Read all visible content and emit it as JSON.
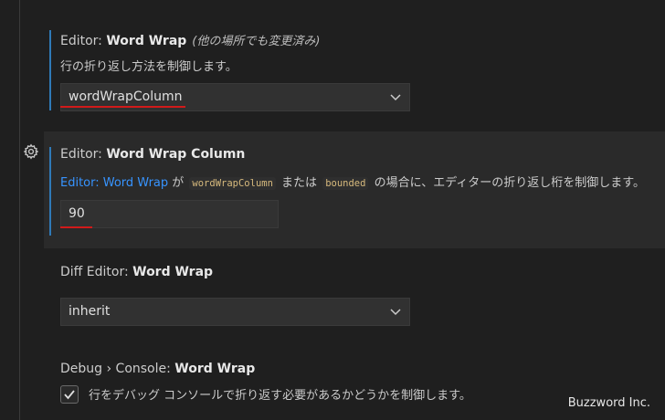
{
  "settings": {
    "word_wrap": {
      "category": "Editor: ",
      "name": "Word Wrap",
      "note": "(他の場所でも変更済み)",
      "description": "行の折り返し方法を制御します。",
      "value": "wordWrapColumn"
    },
    "word_wrap_column": {
      "category": "Editor: ",
      "name": "Word Wrap Column",
      "desc_link": "Editor: Word Wrap",
      "desc_1": " が ",
      "code_1": "wordWrapColumn",
      "desc_2": " または ",
      "code_2": "bounded",
      "desc_3": " の場合に、エディターの折り返し桁を制御します。",
      "value": "90"
    },
    "diff_word_wrap": {
      "category": "Diff Editor: ",
      "name": "Word Wrap",
      "value": "inherit"
    },
    "debug_console_word_wrap": {
      "category": "Debug › Console: ",
      "name": "Word Wrap",
      "checkbox_label": "行をデバッグ コンソールで折り返す必要があるかどうかを制御します。",
      "checked": true
    }
  },
  "watermark": "Buzzword Inc.",
  "colors": {
    "background": "#1f1f1f",
    "focused_row": "#2a2a2a",
    "modified_indicator": "#2f7ab8",
    "link": "#3794ff",
    "annotation_underline": "#d11a1a"
  },
  "icons": [
    "gear-icon",
    "chevron-down-icon",
    "check-icon"
  ]
}
